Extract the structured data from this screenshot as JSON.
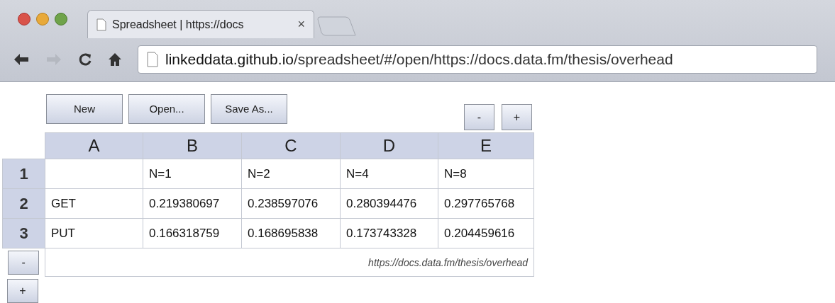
{
  "browser": {
    "tab": {
      "title": "Spreadsheet | https://docs",
      "close": "×",
      "selected": true
    },
    "address": {
      "host": "linkeddata.github.io",
      "path": "/spreadsheet/#/open/https://docs.data.fm/thesis/overhead"
    }
  },
  "toolbar": {
    "buttons": [
      "New",
      "Open...",
      "Save As..."
    ],
    "column_buttons": [
      "-",
      "+"
    ]
  },
  "sheet": {
    "columns": [
      "A",
      "B",
      "C",
      "D",
      "E"
    ],
    "rows": [
      {
        "header": "1",
        "cells": [
          "",
          "N=1",
          "N=2",
          "N=4",
          "N=8"
        ]
      },
      {
        "header": "2",
        "cells": [
          "GET",
          "0.219380697",
          "0.238597076",
          "0.280394476",
          "0.297765768"
        ]
      },
      {
        "header": "3",
        "cells": [
          "PUT",
          "0.166318759",
          "0.168695838",
          "0.173743328",
          "0.204459616"
        ]
      }
    ],
    "source": "https://docs.data.fm/thesis/overhead",
    "row_buttons": [
      "-",
      "+"
    ]
  }
}
